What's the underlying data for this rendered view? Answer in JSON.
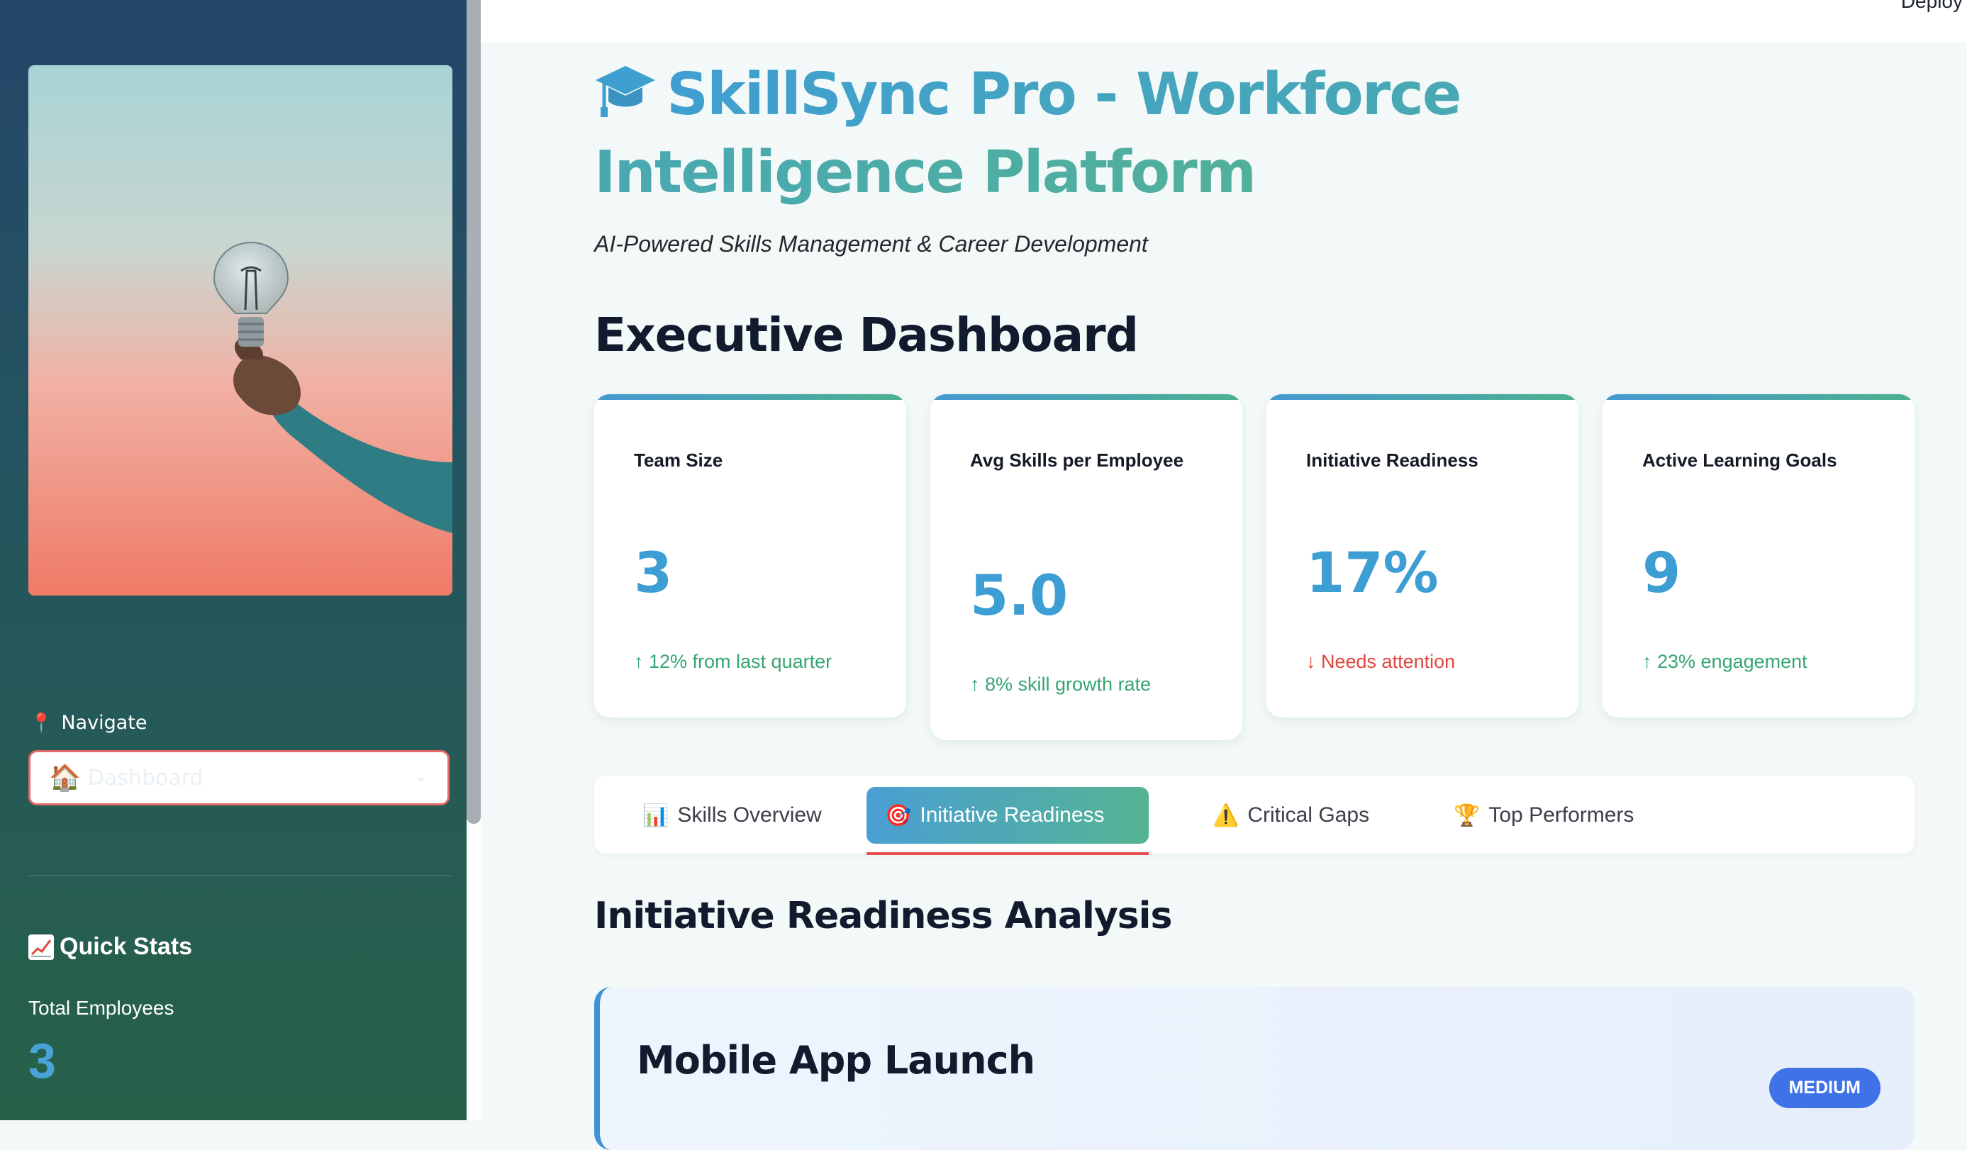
{
  "header": {
    "deploy_label": "Deploy"
  },
  "app": {
    "title": "SkillSync Pro - Workforce Intelligence Platform",
    "subtitle": "AI-Powered Skills Management & Career Development"
  },
  "sidebar": {
    "nav_label": "Navigate",
    "nav_selected": "Dashboard",
    "quick_stats_title": "Quick Stats",
    "total_employees_label": "Total Employees",
    "total_employees_value": "3"
  },
  "dashboard": {
    "title": "Executive Dashboard",
    "metrics": [
      {
        "label": "Team Size",
        "value": "3",
        "delta": "↑ 12% from last quarter",
        "trend": "up"
      },
      {
        "label": "Avg Skills per Employee",
        "value": "5.0",
        "delta": "↑ 8% skill growth rate",
        "trend": "up"
      },
      {
        "label": "Initiative Readiness",
        "value": "17%",
        "delta": "↓ Needs attention",
        "trend": "down"
      },
      {
        "label": "Active Learning Goals",
        "value": "9",
        "delta": "↑ 23% engagement",
        "trend": "up"
      }
    ]
  },
  "tabs": [
    {
      "label": "Skills Overview",
      "icon": "bar-chart-icon",
      "active": false
    },
    {
      "label": "Initiative Readiness",
      "icon": "target-icon",
      "active": true
    },
    {
      "label": "Critical Gaps",
      "icon": "warning-icon",
      "active": false
    },
    {
      "label": "Top Performers",
      "icon": "trophy-icon",
      "active": false
    }
  ],
  "readiness": {
    "section_title": "Initiative Readiness Analysis",
    "initiatives": [
      {
        "name": "Mobile App Launch",
        "priority": "MEDIUM"
      }
    ]
  },
  "colors": {
    "accent_blue": "#3d9ed4",
    "accent_green": "#51b09a",
    "positive": "#36a672",
    "negative": "#e0463f",
    "badge": "#3e72e6"
  }
}
